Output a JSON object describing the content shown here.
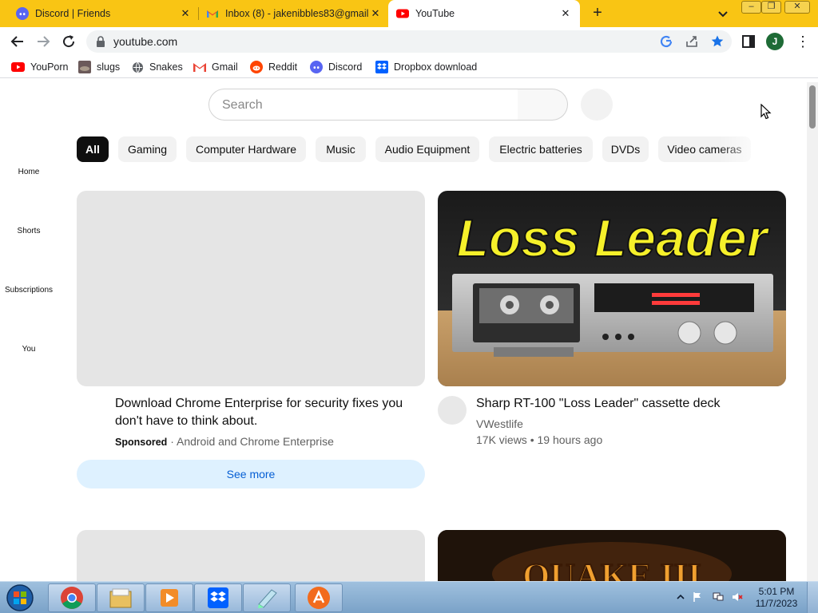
{
  "browser": {
    "tabs": [
      {
        "title": "Discord | Friends",
        "icon": "discord-icon",
        "active": false
      },
      {
        "title": "Inbox (8) - jakenibbles83@gmail",
        "icon": "gmail-icon",
        "active": false
      },
      {
        "title": "YouTube",
        "icon": "youtube-icon",
        "active": true
      }
    ],
    "new_tab": "+",
    "tab_close": "✕",
    "window_controls": {
      "minimize": "–",
      "restore": "❐",
      "close": "✕"
    },
    "address": "youtube.com",
    "profile_initial": "J",
    "menu": "⋮"
  },
  "bookmarks": [
    {
      "label": "YouPorn",
      "icon": "youtube-red-icon"
    },
    {
      "label": "slugs",
      "icon": "slug-image-icon"
    },
    {
      "label": "Snakes",
      "icon": "globe-icon"
    },
    {
      "label": "Gmail",
      "icon": "gmail-icon"
    },
    {
      "label": "Reddit",
      "icon": "reddit-icon"
    },
    {
      "label": "Discord",
      "icon": "discord-icon"
    },
    {
      "label": "Dropbox download",
      "icon": "dropbox-icon"
    }
  ],
  "youtube": {
    "search_placeholder": "Search",
    "chips": [
      "All",
      "Gaming",
      "Computer Hardware",
      "Music",
      "Audio Equipment",
      "Electric batteries",
      "DVDs",
      "Video cameras"
    ],
    "sidebar": [
      "Home",
      "Shorts",
      "Subscriptions",
      "You"
    ],
    "ad": {
      "title": "Download Chrome Enterprise for security fixes you don't have to think about.",
      "sponsored": "Sponsored",
      "advertiser": "Android and Chrome Enterprise",
      "separator": "·",
      "cta": "See more"
    },
    "video": {
      "thumb_text": "Loss Leader",
      "title": "Sharp RT-100 \"Loss Leader\" cassette deck",
      "channel": "VWestlife",
      "views": "17K views",
      "age": "19 hours ago",
      "separator": "•"
    },
    "video2": {
      "thumb_text": "QUAKE III"
    }
  },
  "taskbar": {
    "time": "5:01 PM",
    "date": "11/7/2023",
    "apps": [
      "chrome-icon",
      "file-explorer-icon",
      "media-player-icon",
      "dropbox-icon",
      "notepad-icon",
      "avast-icon"
    ]
  },
  "colors": {
    "tabstrip": "#f9c514",
    "youtube_red": "#ff0000",
    "chip_active": "#0f0f0f",
    "see_more_bg": "#def1ff",
    "link_blue": "#065fd4"
  }
}
